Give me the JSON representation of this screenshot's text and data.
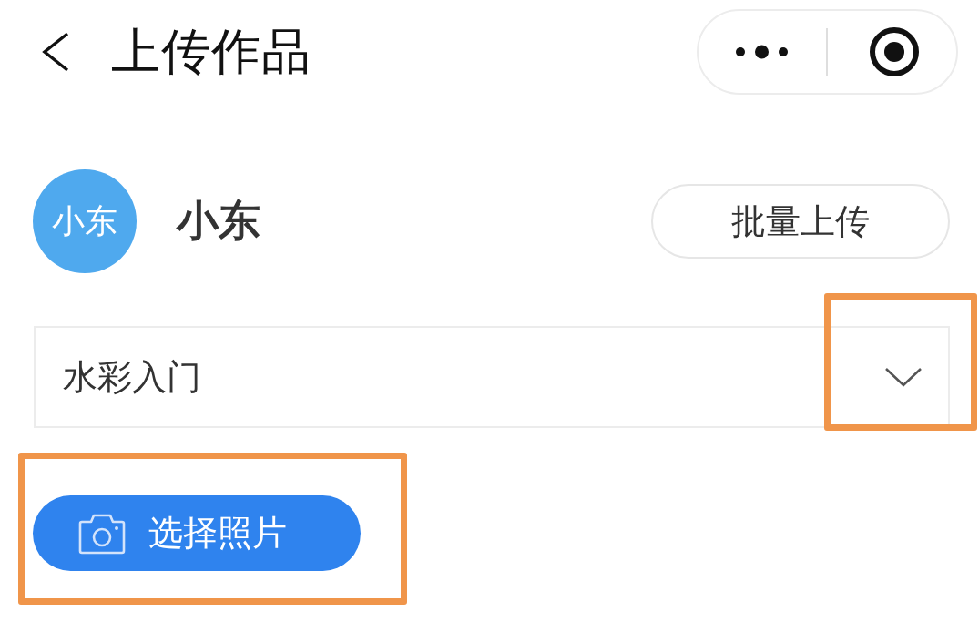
{
  "header": {
    "title": "上传作品"
  },
  "user": {
    "avatar_text": "小东",
    "name": "小东"
  },
  "batch_upload_button": {
    "label": "批量上传"
  },
  "category_select": {
    "value": "水彩入门",
    "arrow_highlighted": true
  },
  "select_photo_button": {
    "label": "选择照片",
    "highlighted": true
  }
}
